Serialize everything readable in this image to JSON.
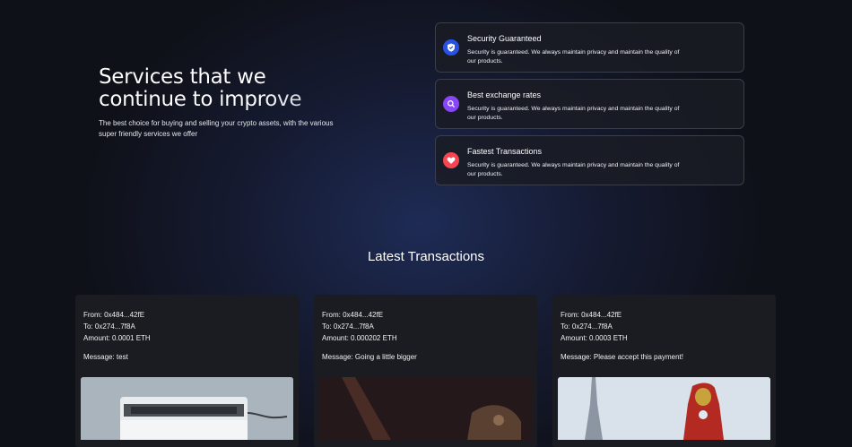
{
  "hero": {
    "title_line1": "Services that we",
    "title_line2": "continue to improve",
    "subtitle": "The best choice for buying and selling your crypto assets, with the various super friendly services we offer"
  },
  "services": [
    {
      "title": "Security Guaranteed",
      "description": "Security is guaranteed. We always maintain privacy and maintain the quality of our products.",
      "icon": "shield-check-icon",
      "color": "#2952e3"
    },
    {
      "title": "Best exchange rates",
      "description": "Security is guaranteed. We always maintain privacy and maintain the quality of our products.",
      "icon": "search-icon",
      "color": "#8945f8"
    },
    {
      "title": "Fastest Transactions",
      "description": "Security is guaranteed. We always maintain privacy and maintain the quality of our products.",
      "icon": "heart-icon",
      "color": "#f84550"
    }
  ],
  "transactions": {
    "title": "Latest Transactions",
    "items": [
      {
        "from": "From: 0x484...42fE",
        "to": "To: 0x274...7f8A",
        "amount": "Amount: 0.0001 ETH",
        "message": "Message: test",
        "image": "printer-photo"
      },
      {
        "from": "From: 0x484...42fE",
        "to": "To: 0x274...7f8A",
        "amount": "Amount: 0.000202 ETH",
        "message": "Message: Going a little bigger",
        "image": "dark-fantasy-photo"
      },
      {
        "from": "From: 0x484...42fE",
        "to": "To: 0x274...7f8A",
        "amount": "Amount: 0.0003 ETH",
        "message": "Message: Please accept this payment!",
        "image": "iron-man-photo"
      }
    ]
  }
}
